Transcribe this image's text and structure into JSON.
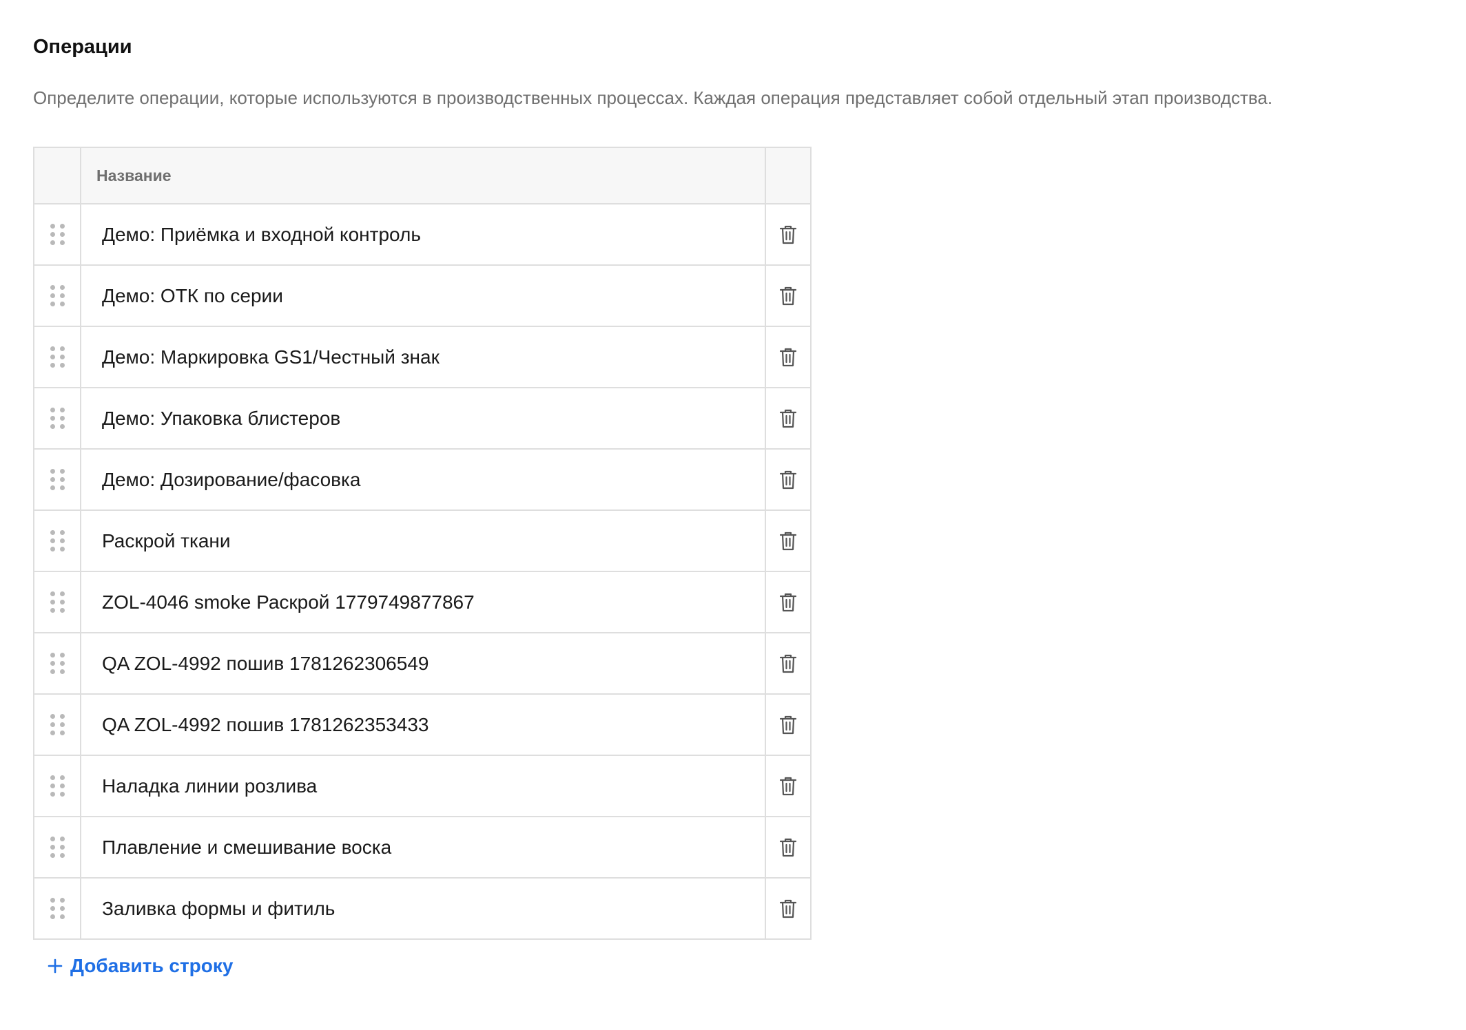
{
  "section": {
    "title": "Операции",
    "description": "Определите операции, которые используются в производственных процессах. Каждая операция представляет собой отдельный этап производства."
  },
  "table": {
    "columns": [
      "",
      "Название",
      ""
    ],
    "rows": [
      {
        "name": "Демо: Приёмка и входной контроль"
      },
      {
        "name": "Демо: ОТК по серии"
      },
      {
        "name": "Демо: Маркировка GS1/Честный знак"
      },
      {
        "name": "Демо: Упаковка блистеров"
      },
      {
        "name": "Демо: Дозирование/фасовка"
      },
      {
        "name": "Раскрой ткани"
      },
      {
        "name": "ZOL-4046 smoke Раскрой 1779749877867"
      },
      {
        "name": "QA ZOL-4992 пошив 1781262306549"
      },
      {
        "name": "QA ZOL-4992 пошив 1781262353433"
      },
      {
        "name": "Наладка линии розлива"
      },
      {
        "name": "Плавление и смешивание воска"
      },
      {
        "name": "Заливка формы и фитиль"
      }
    ],
    "row_icons": {
      "handle": "drag-handle-icon",
      "delete": "trash-icon"
    }
  },
  "actions": {
    "add_row_label": "Добавить строку",
    "add_row_icon": "plus-icon"
  },
  "colors": {
    "accent": "#1f6fe5",
    "border": "#dedede",
    "header_bg": "#f7f7f7",
    "muted_text": "#707070"
  }
}
